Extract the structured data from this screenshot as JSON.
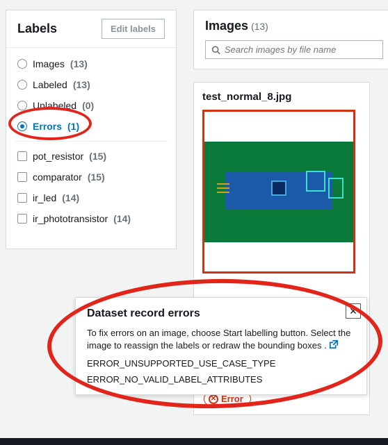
{
  "labels_panel": {
    "title": "Labels",
    "edit_button": "Edit labels",
    "filters": [
      {
        "label": "Images",
        "count": "(13)",
        "selected": false
      },
      {
        "label": "Labeled",
        "count": "(13)",
        "selected": false
      },
      {
        "label": "Unlabeled",
        "count": "(0)",
        "selected": false
      },
      {
        "label": "Errors",
        "count": "(1)",
        "selected": true
      }
    ],
    "label_items": [
      {
        "label": "pot_resistor",
        "count": "(15)"
      },
      {
        "label": "comparator",
        "count": "(15)"
      },
      {
        "label": "ir_led",
        "count": "(14)"
      },
      {
        "label": "ir_phototransistor",
        "count": "(14)"
      }
    ]
  },
  "images_panel": {
    "title": "Images",
    "count": "(13)",
    "search_placeholder": "Search images by file name"
  },
  "image_card": {
    "file_name": "test_normal_8.jpg",
    "error_badge": "Error"
  },
  "popover": {
    "title": "Dataset record errors",
    "description": "To fix errors on an image, choose Start labelling button. Select the image to reassign the labels or redraw the bounding boxes .",
    "error_codes": [
      "ERROR_UNSUPPORTED_USE_CASE_TYPE",
      "ERROR_NO_VALID_LABEL_ATTRIBUTES"
    ]
  },
  "colors": {
    "accent": "#0073bb",
    "danger": "#d13212",
    "highlight": "#e1251b"
  }
}
